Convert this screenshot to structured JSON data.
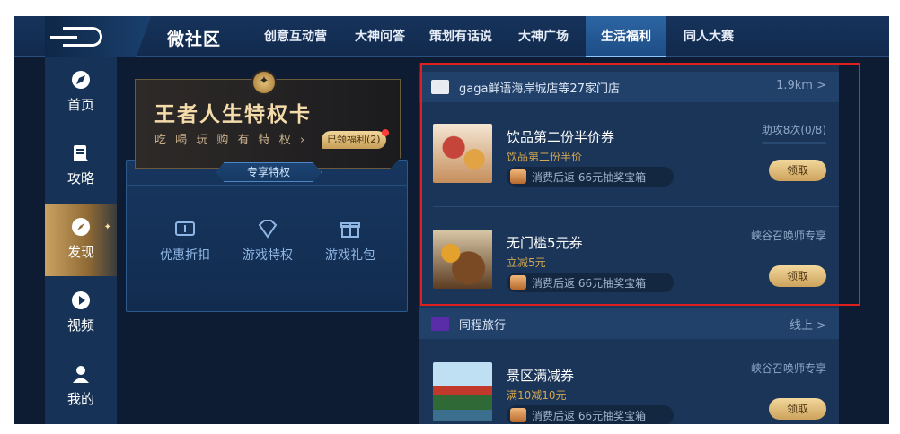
{
  "app": {
    "title": "微社区"
  },
  "tabs": [
    {
      "label": "创意互动营",
      "active": false
    },
    {
      "label": "大神问答",
      "active": false
    },
    {
      "label": "策划有话说",
      "active": false
    },
    {
      "label": "大神广场",
      "active": false
    },
    {
      "label": "生活福利",
      "active": true
    },
    {
      "label": "同人大赛",
      "active": false
    }
  ],
  "sidebar": {
    "items": [
      {
        "label": "首页",
        "icon": "compass-icon"
      },
      {
        "label": "攻略",
        "icon": "document-icon"
      },
      {
        "label": "发现",
        "icon": "discover-icon",
        "active": true
      },
      {
        "label": "视频",
        "icon": "play-icon"
      },
      {
        "label": "我的",
        "icon": "user-icon"
      }
    ]
  },
  "privilege_card": {
    "title": "王者人生特权卡",
    "subtitle": "吃 喝 玩 购 有 特 权",
    "badge": "已领福利(2)",
    "section_label": "专享特权",
    "items": [
      {
        "label": "优惠折扣",
        "icon": "ticket-icon"
      },
      {
        "label": "游戏特权",
        "icon": "diamond-icon"
      },
      {
        "label": "游戏礼包",
        "icon": "gift-icon"
      }
    ]
  },
  "stores": [
    {
      "name": "gaga鲜语海岸城店等27家门店",
      "distance": "1.9km >",
      "offers": [
        {
          "title": "饮品第二份半价券",
          "subtitle": "饮品第二份半价",
          "reward": "消费后返 66元抽奖宝箱",
          "tag": "助攻8次(0/8)",
          "progress": 0,
          "button": "领取"
        },
        {
          "title": "无门槛5元券",
          "subtitle": "立减5元",
          "reward": "消费后返 66元抽奖宝箱",
          "tag": "峡谷召唤师专享",
          "button": "领取"
        }
      ]
    },
    {
      "name": "同程旅行",
      "distance": "线上 >",
      "offers": [
        {
          "title": "景区满减券",
          "subtitle": "满10减10元",
          "reward": "消费后返 66元抽奖宝箱",
          "tag": "峡谷召唤师专享",
          "button": "领取"
        }
      ]
    }
  ]
}
